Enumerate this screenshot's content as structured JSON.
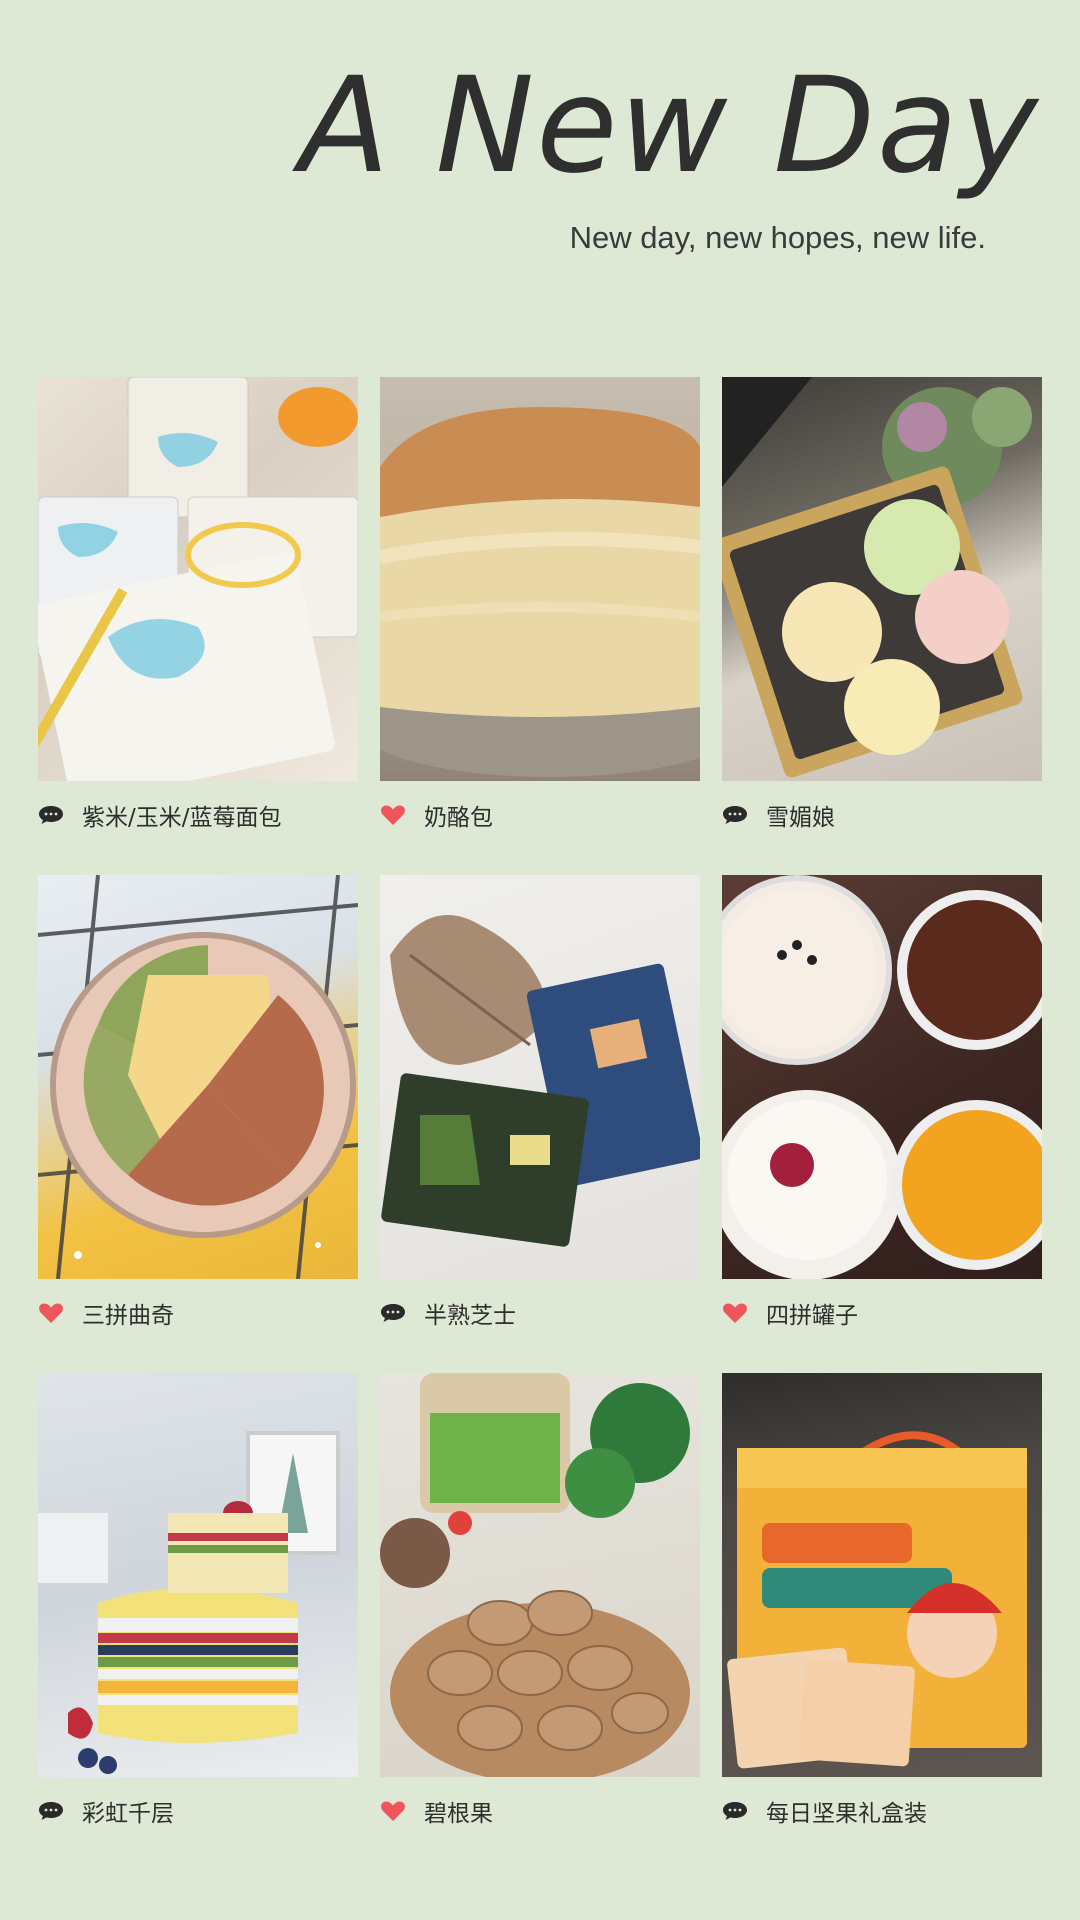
{
  "header": {
    "title": "A New Day",
    "subtitle": "New day, new hopes, new life."
  },
  "items": [
    {
      "label": "紫米/玉米/蓝莓面包",
      "icon": "comment-icon"
    },
    {
      "label": "奶酪包",
      "icon": "heart-icon"
    },
    {
      "label": "雪媚娘",
      "icon": "comment-icon"
    },
    {
      "label": "三拼曲奇",
      "icon": "heart-icon"
    },
    {
      "label": "半熟芝士",
      "icon": "comment-icon"
    },
    {
      "label": "四拼罐子",
      "icon": "heart-icon"
    },
    {
      "label": "彩虹千层",
      "icon": "comment-icon"
    },
    {
      "label": "碧根果",
      "icon": "heart-icon"
    },
    {
      "label": "每日坚果礼盒装",
      "icon": "comment-icon"
    }
  ],
  "colors": {
    "background": "#dde9d4",
    "heart": "#f0555b",
    "comment": "#2a2a2a"
  }
}
